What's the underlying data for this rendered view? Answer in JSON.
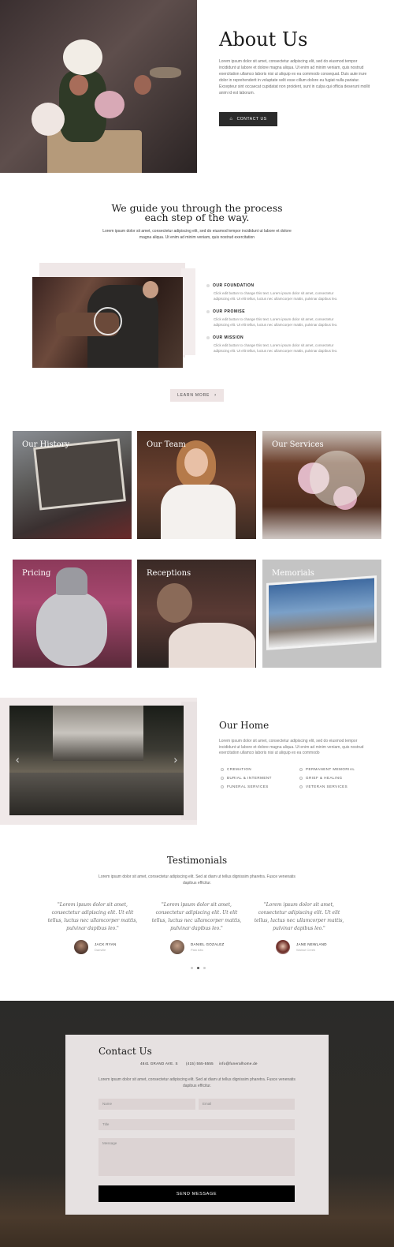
{
  "about": {
    "title": "About Us",
    "text": "Lorem ipsum dolor sit amet, consectetur adipiscing elit, sed do eiusmod tempor incididunt ut labore et dolore magna aliqua. Ut enim ad minim veniam, quis nostrud exercitation ullamco laboris nisi ut aliquip ex ea commodo consequat. Duis aute irure dolor in reprehenderit in voluptate velit esse cillum dolore eu fugiat nulla pariatur. Excepteur sint occaecat cupidatat non proident, sunt in culpa qui officia deserunt mollit anim id est laborum.",
    "button": "CONTACT US"
  },
  "guide": {
    "title_line1": "We guide you through the process",
    "title_line2": "each step of the way.",
    "text": "Lorem ipsum dolor sit amet, consectetur adipiscing elit, sed do eiusmod tempor incididunt ut labore et dolore magna aliqua. Ut enim ad minim veniam, quis nostrud exercitation",
    "features": [
      {
        "title": "OUR FOUNDATION",
        "text": "Click edit button to change this text. Lorem ipsum dolor sit amet, consectetur adipiscing elit. Ut elit tellus, luctus nec ullamcorper mattis, pulvinar dapibus leo."
      },
      {
        "title": "OUR PROMISE",
        "text": "Click edit button to change this text. Lorem ipsum dolor sit amet, consectetur adipiscing elit. Ut elit tellus, luctus nec ullamcorper mattis, pulvinar dapibus leo."
      },
      {
        "title": "OUR MISSION",
        "text": "Click edit button to change this text. Lorem ipsum dolor sit amet, consectetur adipiscing elit. Ut elit tellus, luctus nec ullamcorper mattis, pulvinar dapibus leo."
      }
    ],
    "learn_more": "LEARN MORE"
  },
  "tiles": [
    "Our History",
    "Our Team",
    "Our Services",
    "Pricing",
    "Receptions",
    "Memorials"
  ],
  "home": {
    "title": "Our Home",
    "text": "Lorem ipsum dolor sit amet, consectetur adipiscing elit, sed do eiusmod tempor incididunt ut labore et dolore magna aliqua. Ut enim ad minim veniam, quis nostrud exercitation ullamco laboris nisi ut aliquip ex ea commodo",
    "services_left": [
      "CREMATION",
      "BURIAL & INTERMENT",
      "FUNERAL SERVICES"
    ],
    "services_right": [
      "PERMANENT MEMORIAL",
      "GRIEF & HEALING",
      "VETERAN SERVICES"
    ]
  },
  "testimonials": {
    "title": "Testimonials",
    "text": "Lorem ipsum dolor sit amet, consectetur adipiscing elit. Sed at diam ut tellus dignissim pharetra. Fusce venenatis dapibus efficitur.",
    "items": [
      {
        "quote": "\"Lorem ipsum dolor sit amet, consectetur adipiscing elit. Ut elit tellus, luctus nec ullamcorper mattis, pulvinar dapibus leo.\"",
        "name": "JACK RYAN",
        "role": "Danville"
      },
      {
        "quote": "\"Lorem ipsum dolor sit amet, consectetur adipiscing elit. Ut elit tellus, luctus nec ullamcorper mattis, pulvinar dapibus leo.\"",
        "name": "DANIEL GOZALEZ",
        "role": "Palo Alto"
      },
      {
        "quote": "\"Lorem ipsum dolor sit amet, consectetur adipiscing elit. Ut elit tellus, luctus nec ullamcorper mattis, pulvinar dapibus leo.\"",
        "name": "JANE NEWLAND",
        "role": "Walnut Creek"
      }
    ]
  },
  "contact": {
    "title": "Contact Us",
    "address": "4841 GRAND AVE. S",
    "phone": "(415) 555-5555",
    "email": "info@funeralhome.de",
    "text": "Lorem ipsum dolor sit amet, consectetur adipiscing elit. Sed at diam ut tellus dignissim pharetra. Fusce venenatis dapibus efficitur.",
    "name_placeholder": "Name",
    "email_placeholder": "Email",
    "title_placeholder": "Title",
    "message_placeholder": "Message",
    "send": "SEND MESSAGE"
  },
  "colors": {
    "dark_button": "#2b2b2b",
    "accent_light": "#eee4e4",
    "send_button": "#000000"
  }
}
